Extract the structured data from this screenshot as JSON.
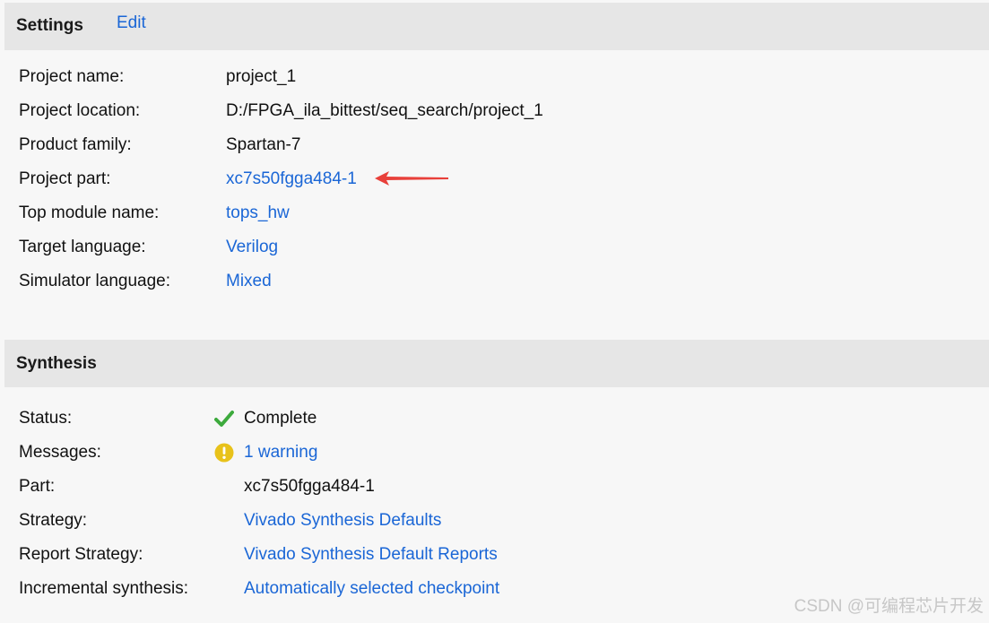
{
  "settings": {
    "title": "Settings",
    "edit_label": "Edit",
    "rows": {
      "project_name": {
        "label": "Project name:",
        "value": "project_1"
      },
      "project_location": {
        "label": "Project location:",
        "value": "D:/FPGA_ila_bittest/seq_search/project_1"
      },
      "product_family": {
        "label": "Product family:",
        "value": "Spartan-7"
      },
      "project_part": {
        "label": "Project part:",
        "value": "xc7s50fgga484-1"
      },
      "top_module": {
        "label": "Top module name:",
        "value": "tops_hw"
      },
      "target_language": {
        "label": "Target language:",
        "value": "Verilog"
      },
      "simulator_language": {
        "label": "Simulator language:",
        "value": "Mixed"
      }
    }
  },
  "synthesis": {
    "title": "Synthesis",
    "rows": {
      "status": {
        "label": "Status:",
        "value": "Complete",
        "icon": "checkmark-icon",
        "icon_color": "#3daa3d"
      },
      "messages": {
        "label": "Messages:",
        "value": "1 warning",
        "icon": "warning-icon",
        "icon_color": "#e8c21a"
      },
      "part": {
        "label": "Part:",
        "value": "xc7s50fgga484-1"
      },
      "strategy": {
        "label": "Strategy:",
        "value": "Vivado Synthesis Defaults"
      },
      "report_strategy": {
        "label": "Report Strategy:",
        "value": "Vivado Synthesis Default Reports"
      },
      "incremental": {
        "label": "Incremental synthesis:",
        "value": "Automatically selected checkpoint"
      }
    }
  },
  "annotation": {
    "icon": "red-arrow-icon",
    "color": "#e8403a"
  },
  "watermark": "CSDN @可编程芯片开发",
  "colors": {
    "link": "#1a66d6",
    "header_bg": "#e6e6e6",
    "page_bg": "#f7f7f7"
  }
}
